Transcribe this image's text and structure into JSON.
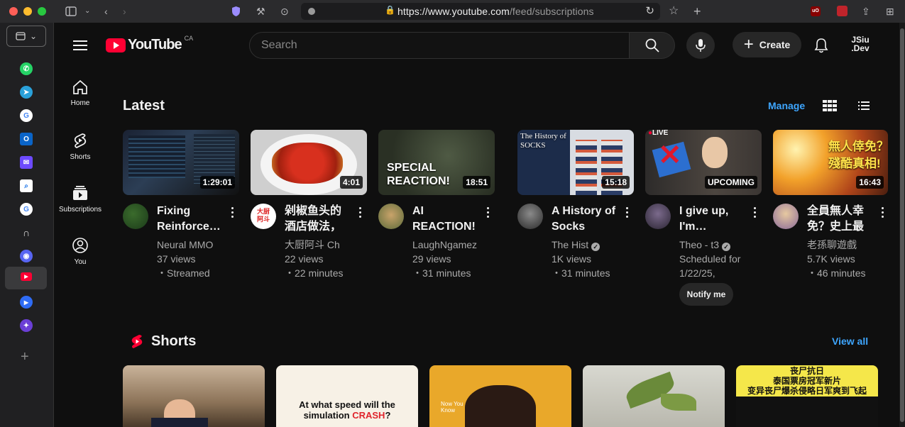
{
  "browser": {
    "url_prefix": "https://www.youtube.com",
    "url_path": "/feed/subscriptions"
  },
  "sidebar_apps": [
    "WhatsApp",
    "Telegram",
    "Google",
    "Outlook",
    "Proton Mail",
    "Search",
    "Google",
    "Headphones",
    "Discord",
    "YouTube",
    "Play",
    "Compass",
    "+"
  ],
  "yt": {
    "logo_text": "YouTube",
    "region": "CA",
    "search_placeholder": "Search",
    "create_label": "Create",
    "account_line1": "JSiu",
    "account_line2": ".Dev",
    "guide": [
      {
        "label": "Home",
        "icon": "home-icon"
      },
      {
        "label": "Shorts",
        "icon": "shorts-icon"
      },
      {
        "label": "Subscriptions",
        "icon": "subscriptions-icon"
      },
      {
        "label": "You",
        "icon": "you-icon"
      }
    ]
  },
  "latest": {
    "title": "Latest",
    "manage_label": "Manage",
    "videos": [
      {
        "duration": "1:29:01",
        "title": "Fixing Reinforcement Learning",
        "channel": "Neural MMO",
        "views": "37 views",
        "age": "・Streamed"
      },
      {
        "duration": "4:01",
        "title": "剁椒鱼头的酒店做法，",
        "channel": "大厨阿斗 Ch",
        "views": "22 views",
        "age": "・22 minutes",
        "avatar_text": "大厨\n阿斗"
      },
      {
        "duration": "18:51",
        "title": "AI REACTION!",
        "channel": "LaughNgamez",
        "views": "29 views",
        "age": "・31 minutes",
        "thumb_text": "SPECIAL\nREACTION!"
      },
      {
        "duration": "15:18",
        "title": "A History of Socks",
        "channel": "The Hist",
        "views": "1K views",
        "age": "・31 minutes",
        "thumb_text": "The History of\nSOCKS"
      },
      {
        "duration": "UPCOMING",
        "title": "I give up, I'm changing",
        "channel": "Theo - t3",
        "views": "Scheduled for",
        "age": "1/22/25,",
        "live_label": "LIVE",
        "notify_label": "Notify me"
      },
      {
        "duration": "16:43",
        "title": "全員無人幸免？史上最",
        "channel": "老孫聊遊戲",
        "views": "5.7K views",
        "age": "・46 minutes",
        "thumb_text": "無人倖免？\n殘酷真相!"
      }
    ]
  },
  "shorts": {
    "title": "Shorts",
    "view_all_label": "View all",
    "items": [
      {
        "text": ""
      },
      {
        "text": "At what speed will the simulation",
        "highlight": "CRASH",
        "tail": "?"
      },
      {
        "text": "Now You Know"
      },
      {
        "text": ""
      },
      {
        "text": "丧尸抗日\n泰国票房冠军新片\n变异丧尸爆杀侵略日军爽到飞起"
      }
    ]
  },
  "colors": {
    "accent": "#3ea6ff",
    "brand": "#ff0033"
  }
}
